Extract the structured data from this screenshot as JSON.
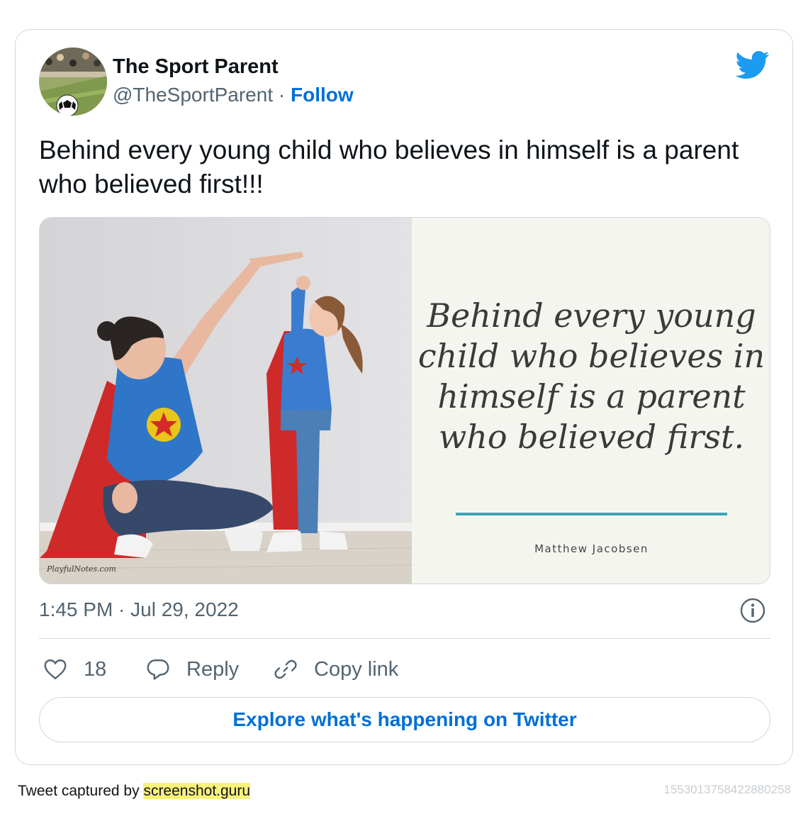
{
  "tweet": {
    "author_name": "The Sport Parent",
    "handle": "@TheSportParent",
    "separator": " · ",
    "follow_label": "Follow",
    "text": "Behind every young child who believes in himself is a parent who believed first!!!",
    "timestamp": "1:45 PM · Jul 29, 2022"
  },
  "media": {
    "quote": "Behind every young child who believes in himself is a parent who believed first.",
    "quote_author": "Matthew Jacobsen",
    "watermark": "PlayfulNotes.com"
  },
  "actions": {
    "like_count": "18",
    "reply_label": "Reply",
    "copy_label": "Copy link"
  },
  "explore_label": "Explore what's happening on Twitter",
  "footer": {
    "captured_prefix": "Tweet captured by ",
    "captured_site": "screenshot.guru",
    "tweet_id": "1553013758422880258"
  },
  "icons": {
    "brand": "twitter-bird-icon",
    "info": "info-icon",
    "like": "heart-icon",
    "reply": "speech-bubble-icon",
    "copy": "link-icon"
  },
  "colors": {
    "twitter_blue": "#1d9bf0",
    "link_blue": "#006fd6",
    "muted_text": "#536471",
    "border": "#cfd9de",
    "highlight": "#f8f17a",
    "quote_rule": "#3fa3b8"
  }
}
